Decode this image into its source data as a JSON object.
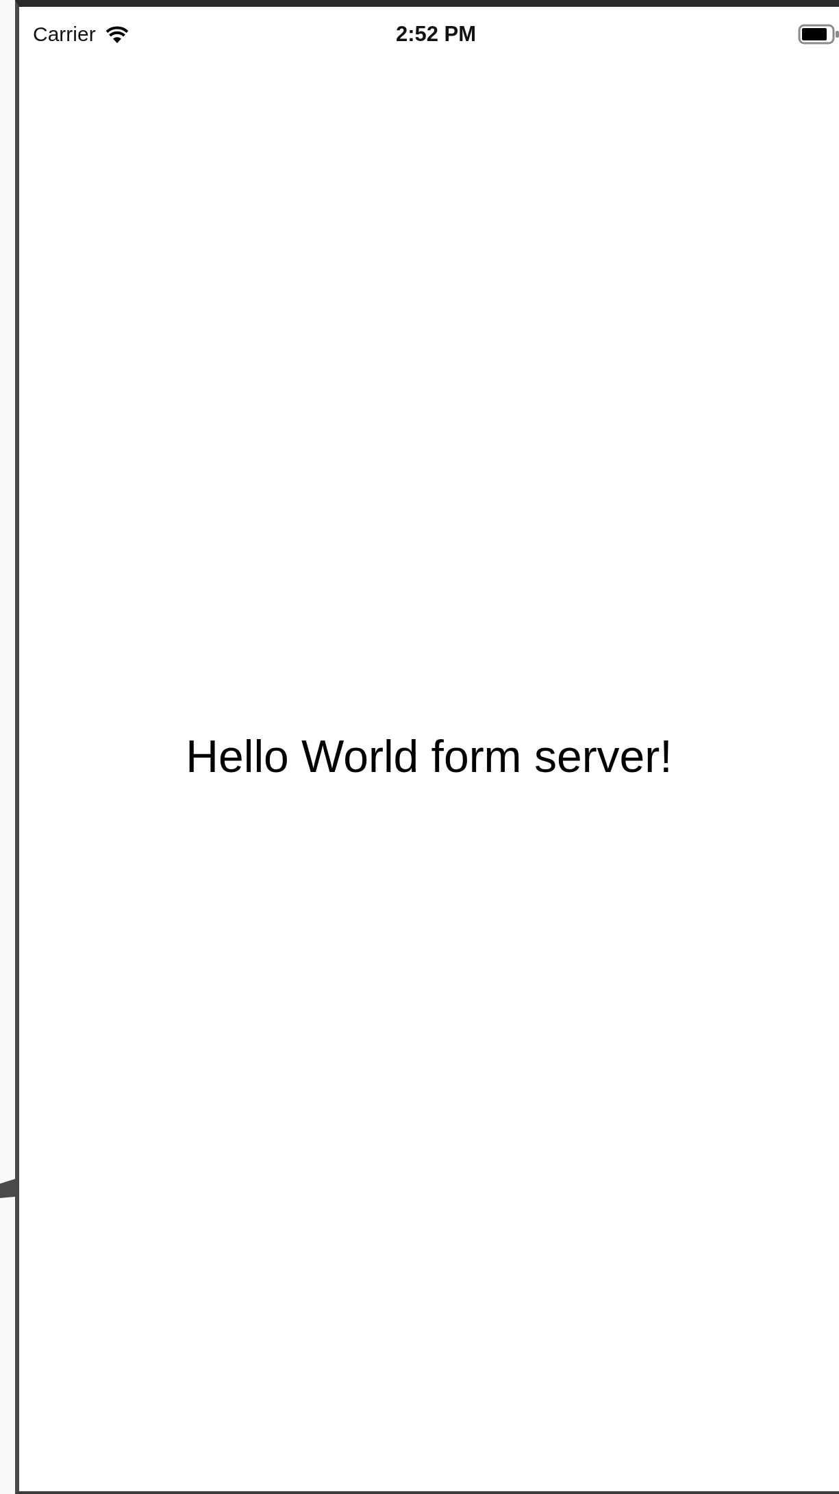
{
  "status_bar": {
    "carrier": "Carrier",
    "time": "2:52 PM"
  },
  "message": "Hello World form server!"
}
